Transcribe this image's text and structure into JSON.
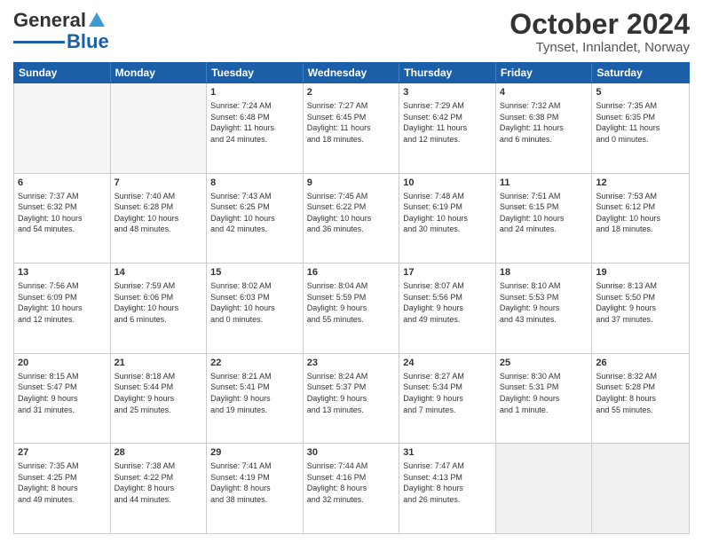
{
  "logo": {
    "line1": "General",
    "line2": "Blue"
  },
  "title": "October 2024",
  "subtitle": "Tynset, Innlandet, Norway",
  "days": [
    "Sunday",
    "Monday",
    "Tuesday",
    "Wednesday",
    "Thursday",
    "Friday",
    "Saturday"
  ],
  "weeks": [
    [
      {
        "day": "",
        "info": ""
      },
      {
        "day": "",
        "info": ""
      },
      {
        "day": "1",
        "info": "Sunrise: 7:24 AM\nSunset: 6:48 PM\nDaylight: 11 hours\nand 24 minutes."
      },
      {
        "day": "2",
        "info": "Sunrise: 7:27 AM\nSunset: 6:45 PM\nDaylight: 11 hours\nand 18 minutes."
      },
      {
        "day": "3",
        "info": "Sunrise: 7:29 AM\nSunset: 6:42 PM\nDaylight: 11 hours\nand 12 minutes."
      },
      {
        "day": "4",
        "info": "Sunrise: 7:32 AM\nSunset: 6:38 PM\nDaylight: 11 hours\nand 6 minutes."
      },
      {
        "day": "5",
        "info": "Sunrise: 7:35 AM\nSunset: 6:35 PM\nDaylight: 11 hours\nand 0 minutes."
      }
    ],
    [
      {
        "day": "6",
        "info": "Sunrise: 7:37 AM\nSunset: 6:32 PM\nDaylight: 10 hours\nand 54 minutes."
      },
      {
        "day": "7",
        "info": "Sunrise: 7:40 AM\nSunset: 6:28 PM\nDaylight: 10 hours\nand 48 minutes."
      },
      {
        "day": "8",
        "info": "Sunrise: 7:43 AM\nSunset: 6:25 PM\nDaylight: 10 hours\nand 42 minutes."
      },
      {
        "day": "9",
        "info": "Sunrise: 7:45 AM\nSunset: 6:22 PM\nDaylight: 10 hours\nand 36 minutes."
      },
      {
        "day": "10",
        "info": "Sunrise: 7:48 AM\nSunset: 6:19 PM\nDaylight: 10 hours\nand 30 minutes."
      },
      {
        "day": "11",
        "info": "Sunrise: 7:51 AM\nSunset: 6:15 PM\nDaylight: 10 hours\nand 24 minutes."
      },
      {
        "day": "12",
        "info": "Sunrise: 7:53 AM\nSunset: 6:12 PM\nDaylight: 10 hours\nand 18 minutes."
      }
    ],
    [
      {
        "day": "13",
        "info": "Sunrise: 7:56 AM\nSunset: 6:09 PM\nDaylight: 10 hours\nand 12 minutes."
      },
      {
        "day": "14",
        "info": "Sunrise: 7:59 AM\nSunset: 6:06 PM\nDaylight: 10 hours\nand 6 minutes."
      },
      {
        "day": "15",
        "info": "Sunrise: 8:02 AM\nSunset: 6:03 PM\nDaylight: 10 hours\nand 0 minutes."
      },
      {
        "day": "16",
        "info": "Sunrise: 8:04 AM\nSunset: 5:59 PM\nDaylight: 9 hours\nand 55 minutes."
      },
      {
        "day": "17",
        "info": "Sunrise: 8:07 AM\nSunset: 5:56 PM\nDaylight: 9 hours\nand 49 minutes."
      },
      {
        "day": "18",
        "info": "Sunrise: 8:10 AM\nSunset: 5:53 PM\nDaylight: 9 hours\nand 43 minutes."
      },
      {
        "day": "19",
        "info": "Sunrise: 8:13 AM\nSunset: 5:50 PM\nDaylight: 9 hours\nand 37 minutes."
      }
    ],
    [
      {
        "day": "20",
        "info": "Sunrise: 8:15 AM\nSunset: 5:47 PM\nDaylight: 9 hours\nand 31 minutes."
      },
      {
        "day": "21",
        "info": "Sunrise: 8:18 AM\nSunset: 5:44 PM\nDaylight: 9 hours\nand 25 minutes."
      },
      {
        "day": "22",
        "info": "Sunrise: 8:21 AM\nSunset: 5:41 PM\nDaylight: 9 hours\nand 19 minutes."
      },
      {
        "day": "23",
        "info": "Sunrise: 8:24 AM\nSunset: 5:37 PM\nDaylight: 9 hours\nand 13 minutes."
      },
      {
        "day": "24",
        "info": "Sunrise: 8:27 AM\nSunset: 5:34 PM\nDaylight: 9 hours\nand 7 minutes."
      },
      {
        "day": "25",
        "info": "Sunrise: 8:30 AM\nSunset: 5:31 PM\nDaylight: 9 hours\nand 1 minute."
      },
      {
        "day": "26",
        "info": "Sunrise: 8:32 AM\nSunset: 5:28 PM\nDaylight: 8 hours\nand 55 minutes."
      }
    ],
    [
      {
        "day": "27",
        "info": "Sunrise: 7:35 AM\nSunset: 4:25 PM\nDaylight: 8 hours\nand 49 minutes."
      },
      {
        "day": "28",
        "info": "Sunrise: 7:38 AM\nSunset: 4:22 PM\nDaylight: 8 hours\nand 44 minutes."
      },
      {
        "day": "29",
        "info": "Sunrise: 7:41 AM\nSunset: 4:19 PM\nDaylight: 8 hours\nand 38 minutes."
      },
      {
        "day": "30",
        "info": "Sunrise: 7:44 AM\nSunset: 4:16 PM\nDaylight: 8 hours\nand 32 minutes."
      },
      {
        "day": "31",
        "info": "Sunrise: 7:47 AM\nSunset: 4:13 PM\nDaylight: 8 hours\nand 26 minutes."
      },
      {
        "day": "",
        "info": ""
      },
      {
        "day": "",
        "info": ""
      }
    ]
  ]
}
